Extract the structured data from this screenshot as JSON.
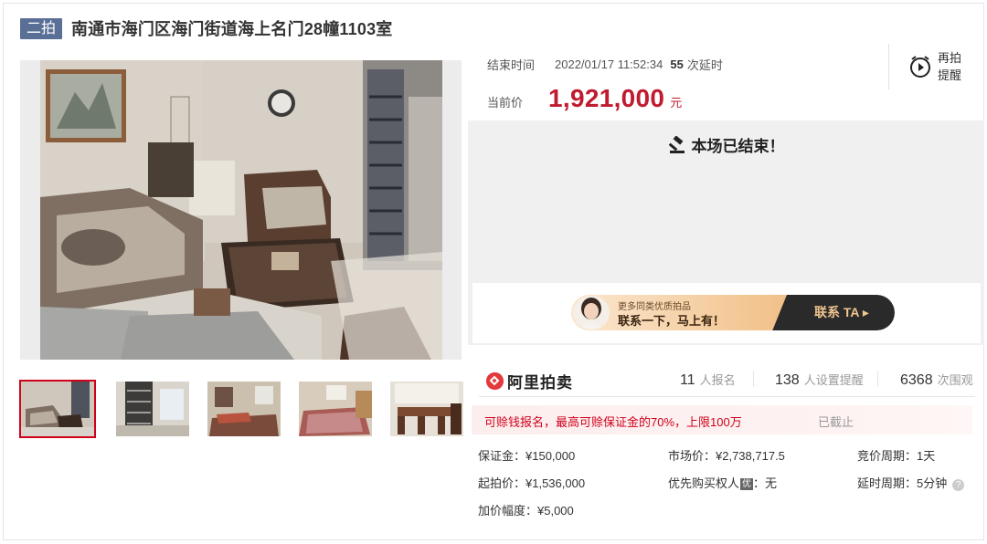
{
  "header": {
    "round_badge": "二拍",
    "title": "南通市海门区海门街道海上名门28幢1103室"
  },
  "auction": {
    "end_time_label": "结束时间",
    "end_time_value": "2022/01/17 11:52:34",
    "delay_count": "55",
    "delay_text": "次延时",
    "price_label": "当前价",
    "price_value": "1,921,000",
    "price_unit": "元",
    "remind_label": "再拍提醒",
    "ended_message": "本场已结束！"
  },
  "promo": {
    "small_text": "更多同类优质拍品",
    "big_text": "联系一下，马上有！",
    "cta_label": "联系 TA ▸"
  },
  "stats": {
    "platform_name": "阿里拍卖",
    "signup_count": "11",
    "signup_text": "人报名",
    "reminder_count": "138",
    "reminder_text": "人设置提醒",
    "view_count": "6368",
    "view_text": "次围观"
  },
  "deposit_banner": {
    "message": "可赊钱报名，最高可赊保证金的70%，上限100万",
    "status": "已截止"
  },
  "details": {
    "deposit": "保证金：¥150,000",
    "market_price": "市场价：¥2,738,717.5",
    "bid_cycle": "竞价周期：1天",
    "start_price": "起拍价：¥1,536,000",
    "priority_label": "优先购买权人",
    "priority_badge": "优",
    "priority_value": "：无",
    "delay_cycle": "延时周期：5分钟",
    "increment": "加价幅度：¥5,000",
    "help_glyph": "?"
  },
  "icons": {
    "gavel": "gavel-icon",
    "clock": "alarm-clock-icon",
    "logo": "ali-auction-logo-icon"
  },
  "colors": {
    "price_red": "#c01b2f",
    "badge_blue": "#5a6f96",
    "alert_red": "#d0021b"
  }
}
